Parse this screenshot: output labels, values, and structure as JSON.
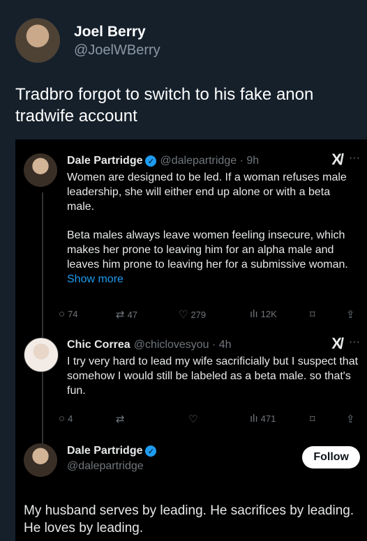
{
  "outer_tweet": {
    "name": "Joel Berry",
    "handle": "@JoelWBerry",
    "text": "Tradbro forgot to switch to his fake anon tradwife account"
  },
  "quoted_thread": {
    "post1": {
      "name": "Dale Partridge",
      "handle_time": "@dalepartridge · 9h",
      "text_p1": "Women are designed to be led. If a woman refuses male leadership, she will either end up alone or with a beta male.",
      "text_p2": "Beta males always leave women feeling insecure, which makes her prone to leaving him for an alpha male and leaves him prone to leaving her for a submissive woman.",
      "show_more": "Show more",
      "replies": "74",
      "retweets": "47",
      "likes": "279",
      "views": "12K"
    },
    "post2": {
      "name": "Chic Correa",
      "handle_time": "@chiclovesyou · 4h",
      "text": "I try very hard to lead my wife sacrificially but I suspect that somehow I would still be labeled as a beta male. so that's fun.",
      "replies": "4",
      "views": "471"
    },
    "post3": {
      "name": "Dale Partridge",
      "handle": "@dalepartridge",
      "follow_label": "Follow",
      "text": "My husband serves by leading. He sacrifices by leading. He loves by leading."
    }
  },
  "icons": {
    "grok": "X/",
    "more": "···",
    "reply": "○",
    "retweet": "⇄",
    "like": "♡",
    "views": "ılı",
    "bookmark": "⌑",
    "share": "⇪"
  },
  "colors": {
    "background": "#15202b",
    "embed_bg": "#000000",
    "accent": "#1d9bf0",
    "muted": "#71767b"
  }
}
